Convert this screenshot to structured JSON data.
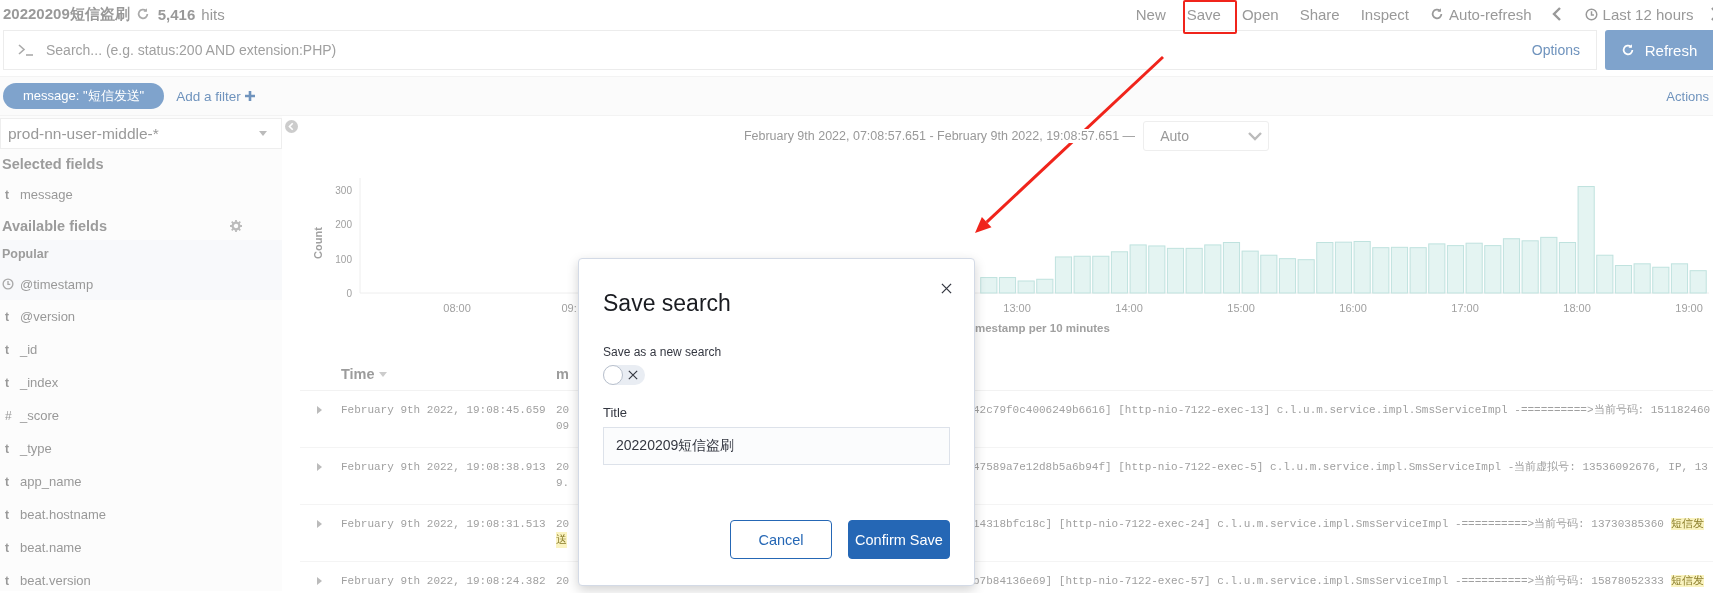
{
  "header": {
    "title": "20220209短信盗刷",
    "hits_count": "5,416",
    "hits_label": "hits"
  },
  "top_menu": [
    {
      "kind": "text",
      "label": "New"
    },
    {
      "kind": "text",
      "label": "Save"
    },
    {
      "kind": "text",
      "label": "Open"
    },
    {
      "kind": "text",
      "label": "Share"
    },
    {
      "kind": "text",
      "label": "Inspect"
    },
    {
      "kind": "refresh",
      "label": "Auto-refresh"
    },
    {
      "kind": "prev"
    },
    {
      "kind": "time",
      "label": "Last 12 hours"
    },
    {
      "kind": "next"
    }
  ],
  "query": {
    "placeholder": "Search... (e.g. status:200 AND extension:PHP)",
    "options": "Options",
    "submit": "Refresh"
  },
  "filters": {
    "pills": [
      {
        "label": "message: \"短信发送\""
      }
    ],
    "add": "Add a filter",
    "actions": "Actions"
  },
  "sidebar": {
    "index_pattern": "prod-nn-user-middle-*",
    "selected_heading": "Selected fields",
    "selected": [
      {
        "kind": "string",
        "symbol": "t",
        "name": "message"
      }
    ],
    "available_heading": "Available fields",
    "popular_heading": "Popular",
    "popular": [
      {
        "kind": "date",
        "name": "@timestamp"
      }
    ],
    "fields": [
      {
        "kind": "string",
        "symbol": "t",
        "name": "@version"
      },
      {
        "kind": "string",
        "symbol": "t",
        "name": "_id"
      },
      {
        "kind": "string",
        "symbol": "t",
        "name": "_index"
      },
      {
        "kind": "number",
        "symbol": "#",
        "name": "_score"
      },
      {
        "kind": "string",
        "symbol": "t",
        "name": "_type"
      },
      {
        "kind": "string",
        "symbol": "t",
        "name": "app_name"
      },
      {
        "kind": "string",
        "symbol": "t",
        "name": "beat.hostname"
      },
      {
        "kind": "string",
        "symbol": "t",
        "name": "beat.name"
      },
      {
        "kind": "string",
        "symbol": "t",
        "name": "beat.version"
      }
    ]
  },
  "histogram": {
    "cut_tick_label": "09:",
    "range": "February 9th 2022, 07:08:57.651 - February 9th 2022, 19:08:57.651 —",
    "interval": "Auto",
    "chart_data": {
      "type": "bar",
      "ylabel": "Count",
      "xlabel": "mestamp per 10 minutes",
      "x": [
        435,
        445,
        455,
        465,
        475,
        485,
        495,
        505,
        515,
        525,
        535,
        545,
        555,
        565,
        575,
        585,
        595,
        605,
        615,
        625,
        635,
        645,
        655,
        665,
        675,
        685,
        695,
        705,
        715,
        725,
        735,
        745,
        755,
        765,
        775,
        785,
        795,
        805,
        815,
        825,
        835,
        845,
        855,
        865,
        875,
        885,
        895,
        905,
        915,
        925,
        935,
        945,
        955,
        965,
        975,
        985,
        995,
        1005,
        1015,
        1025,
        1035,
        1045,
        1055,
        1065,
        1075,
        1085,
        1095,
        1105,
        1115,
        1125,
        1135,
        1145
      ],
      "series": [
        {
          "color": "#e4f4f2",
          "values": [
            0,
            0,
            0,
            0,
            0,
            0,
            0,
            0,
            0,
            0,
            0,
            0,
            null,
            null,
            null,
            null,
            null,
            null,
            null,
            null,
            null,
            null,
            null,
            null,
            null,
            null,
            null,
            null,
            null,
            null,
            null,
            null,
            null,
            45,
            45,
            35,
            40,
            105,
            107,
            107,
            120,
            140,
            137,
            130,
            130,
            140,
            147,
            122,
            110,
            100,
            97,
            147,
            148,
            150,
            132,
            133,
            132,
            143,
            138,
            145,
            138,
            158,
            152,
            162,
            147,
            310,
            110,
            80,
            85,
            75,
            85,
            65
          ]
        }
      ],
      "xlim": [
        428,
        1148
      ],
      "ylim": [
        0,
        320
      ],
      "yticks": [
        0,
        100,
        200,
        300
      ],
      "xticks": [
        {
          "value": 480,
          "label": "08:00"
        },
        {
          "value": 780,
          "label": "13:00"
        },
        {
          "value": 840,
          "label": "14:00"
        },
        {
          "value": 900,
          "label": "15:00"
        },
        {
          "value": 960,
          "label": "16:00"
        },
        {
          "value": 1020,
          "label": "17:00"
        },
        {
          "value": 1080,
          "label": "18:00"
        },
        {
          "value": 1140,
          "label": "19:00"
        }
      ]
    }
  },
  "table": {
    "columns": [
      "Time",
      "m"
    ],
    "rows": [
      {
        "time": "February 9th 2022, 19:08:45.659",
        "start": "20",
        "tail": "42c79f0c4006249b6616] [http-nio-7122-exec-13] c.l.u.m.service.impl.SmsServiceImpl -==========>当前号码: 151182460",
        "wrap": {
          "text": "09",
          "highlighted": false
        }
      },
      {
        "time": "February 9th 2022, 19:08:38.913",
        "start": "20",
        "tail": "47589a7e12d8b5a6b94f] [http-nio-7122-exec-5] c.l.u.m.service.impl.SmsServiceImpl -当前虚拟号: 13536092676, IP, 13",
        "wrap": {
          "text": "9.",
          "highlighted": false
        }
      },
      {
        "time": "February 9th 2022, 19:08:31.513",
        "start": "20",
        "tail": "14318bfc18c] [http-nio-7122-exec-24] c.l.u.m.service.impl.SmsServiceImpl -==========>当前号码: 13730385360 ",
        "highlight": "短信发",
        "wrap": {
          "text": "送",
          "highlighted": true
        }
      },
      {
        "time": "February 9th 2022, 19:08:24.382",
        "start": "20",
        "tail": "b7b84136e69] [http-nio-7122-exec-57] c.l.u.m.service.impl.SmsServiceImpl -==========>当前号码: 15878052333 ",
        "highlight": "短信发"
      }
    ]
  },
  "modal": {
    "title": "Save search",
    "toggle_label": "Save as a new search",
    "save_as_new": {
      "on": false
    },
    "field_label": "Title",
    "field_value": "20220209短信盗刷",
    "cancel": "Cancel",
    "confirm": "Confirm Save"
  }
}
